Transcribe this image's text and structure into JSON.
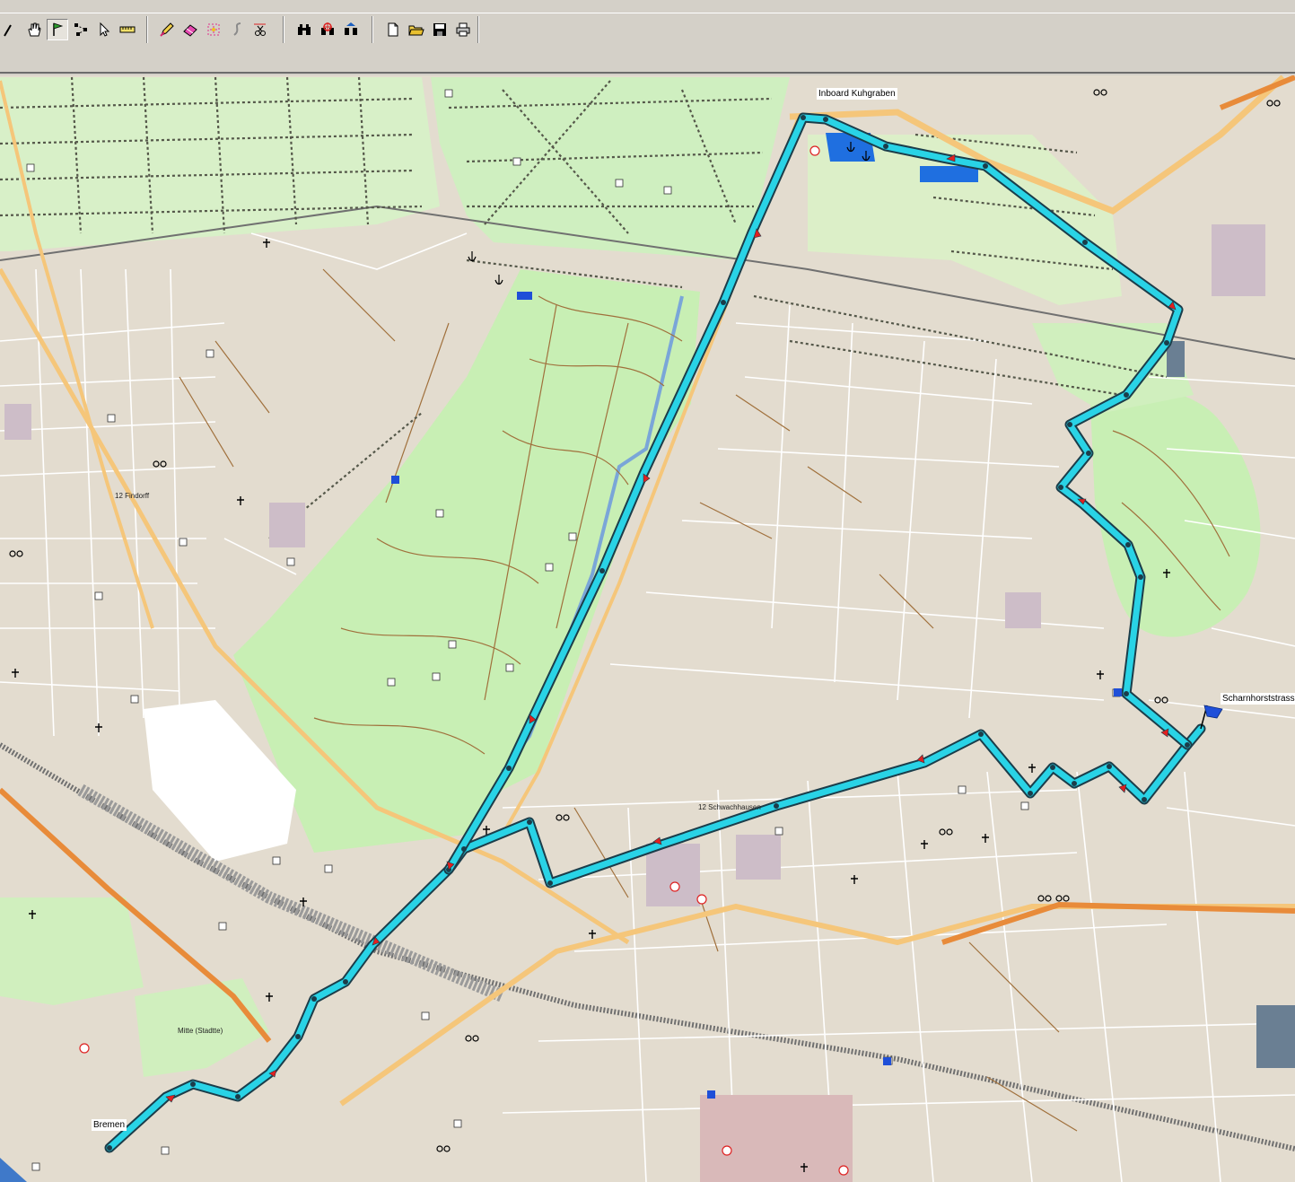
{
  "toolbar": {
    "groups": [
      {
        "name": "navigation",
        "buttons": [
          {
            "icon": "zoom-icon",
            "label": "Zoom"
          },
          {
            "icon": "hand-pan-icon",
            "label": "Pan"
          },
          {
            "icon": "flag-waypoint-icon",
            "label": "Waypoint",
            "pressed": true
          },
          {
            "icon": "route-points-icon",
            "label": "Route"
          },
          {
            "icon": "cursor-select-icon",
            "label": "Select"
          },
          {
            "icon": "ruler-measure-icon",
            "label": "Measure"
          }
        ]
      },
      {
        "name": "edit",
        "buttons": [
          {
            "icon": "pencil-draw-icon",
            "label": "Draw"
          },
          {
            "icon": "eraser-icon",
            "label": "Erase"
          },
          {
            "icon": "magic-select-icon",
            "label": "Select Area"
          },
          {
            "icon": "track-curve-icon",
            "label": "Track"
          },
          {
            "icon": "scissors-cut-icon",
            "label": "Cut"
          }
        ]
      },
      {
        "name": "search",
        "buttons": [
          {
            "icon": "binoculars-icon",
            "label": "Find"
          },
          {
            "icon": "binoculars-target-icon",
            "label": "Find Nearest"
          },
          {
            "icon": "binoculars-address-icon",
            "label": "Find Address"
          }
        ]
      },
      {
        "name": "file",
        "buttons": [
          {
            "icon": "new-file-icon",
            "label": "New"
          },
          {
            "icon": "open-folder-icon",
            "label": "Open"
          },
          {
            "icon": "save-disk-icon",
            "label": "Save"
          },
          {
            "icon": "print-icon",
            "label": "Print"
          }
        ]
      }
    ]
  },
  "map": {
    "labels": {
      "inboard": "Inboard Kuhgraben",
      "scharnhorst": "Scharnhorststrass",
      "bremen": "Bremen",
      "schwachhausen": "12 Schwachhausen",
      "mitte": "Mitte (Stadtte)",
      "findorff": "12 Findorff"
    },
    "colors": {
      "background": "#e3dccf",
      "park": "#c8efb4",
      "route": "#29d3e6",
      "route_outline": "#1b3d4a",
      "major_road": "#f5c67a",
      "highway": "#e88b3a",
      "water": "#3f79c9",
      "railway": "#707070",
      "path": "#a0703c"
    }
  }
}
